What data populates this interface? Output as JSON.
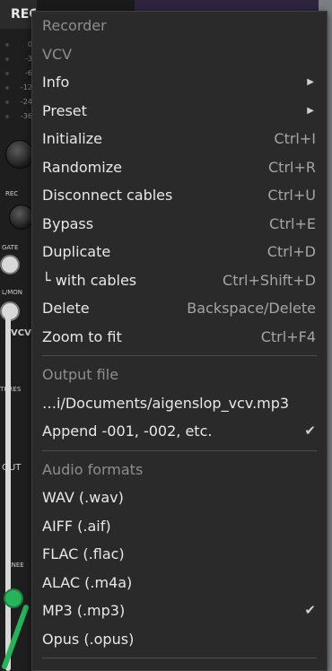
{
  "module": {
    "title": "REC",
    "vu_labels": [
      "0",
      "-3",
      "-6",
      "-12",
      "-24",
      "-36"
    ],
    "labels": {
      "rec": "REC",
      "gate": "GATE",
      "mon": "L/MON",
      "vcv": "VCV",
      "thresh": "THRES",
      "out": "OUT",
      "knee": "KNEE"
    }
  },
  "menu": {
    "title": "Recorder",
    "brand": "VCV",
    "info": "Info",
    "preset": "Preset",
    "initialize": {
      "label": "Initialize",
      "shortcut": "Ctrl+I"
    },
    "randomize": {
      "label": "Randomize",
      "shortcut": "Ctrl+R"
    },
    "disconnect": {
      "label": "Disconnect cables",
      "shortcut": "Ctrl+U"
    },
    "bypass": {
      "label": "Bypass",
      "shortcut": "Ctrl+E"
    },
    "duplicate": {
      "label": "Duplicate",
      "shortcut": "Ctrl+D"
    },
    "with_cables": {
      "label": "└ with cables",
      "shortcut": "Ctrl+Shift+D"
    },
    "delete": {
      "label": "Delete",
      "shortcut": "Backspace/Delete"
    },
    "zoom": {
      "label": "Zoom to fit",
      "shortcut": "Ctrl+F4"
    },
    "output_file_header": "Output file",
    "output_path": "…i/Documents/aigenslop_vcv.mp3",
    "append": {
      "label": "Append -001, -002, etc.",
      "check": "✔"
    },
    "audio_formats_header": "Audio formats",
    "formats": [
      {
        "label": "WAV (.wav)",
        "check": ""
      },
      {
        "label": "AIFF (.aif)",
        "check": ""
      },
      {
        "label": "FLAC (.flac)",
        "check": ""
      },
      {
        "label": "ALAC (.m4a)",
        "check": ""
      },
      {
        "label": "MP3 (.mp3)",
        "check": "✔"
      },
      {
        "label": "Opus (.opus)",
        "check": ""
      }
    ],
    "submenu_arrow": "▶"
  },
  "colors": {
    "menu_bg": "#2a2a2a",
    "header_text": "#8e8e8e",
    "item_text": "#e8e8e8",
    "shortcut_text": "#a5a5a5",
    "cable_green": "#27b35a",
    "cable_white": "#d9d9d9"
  }
}
